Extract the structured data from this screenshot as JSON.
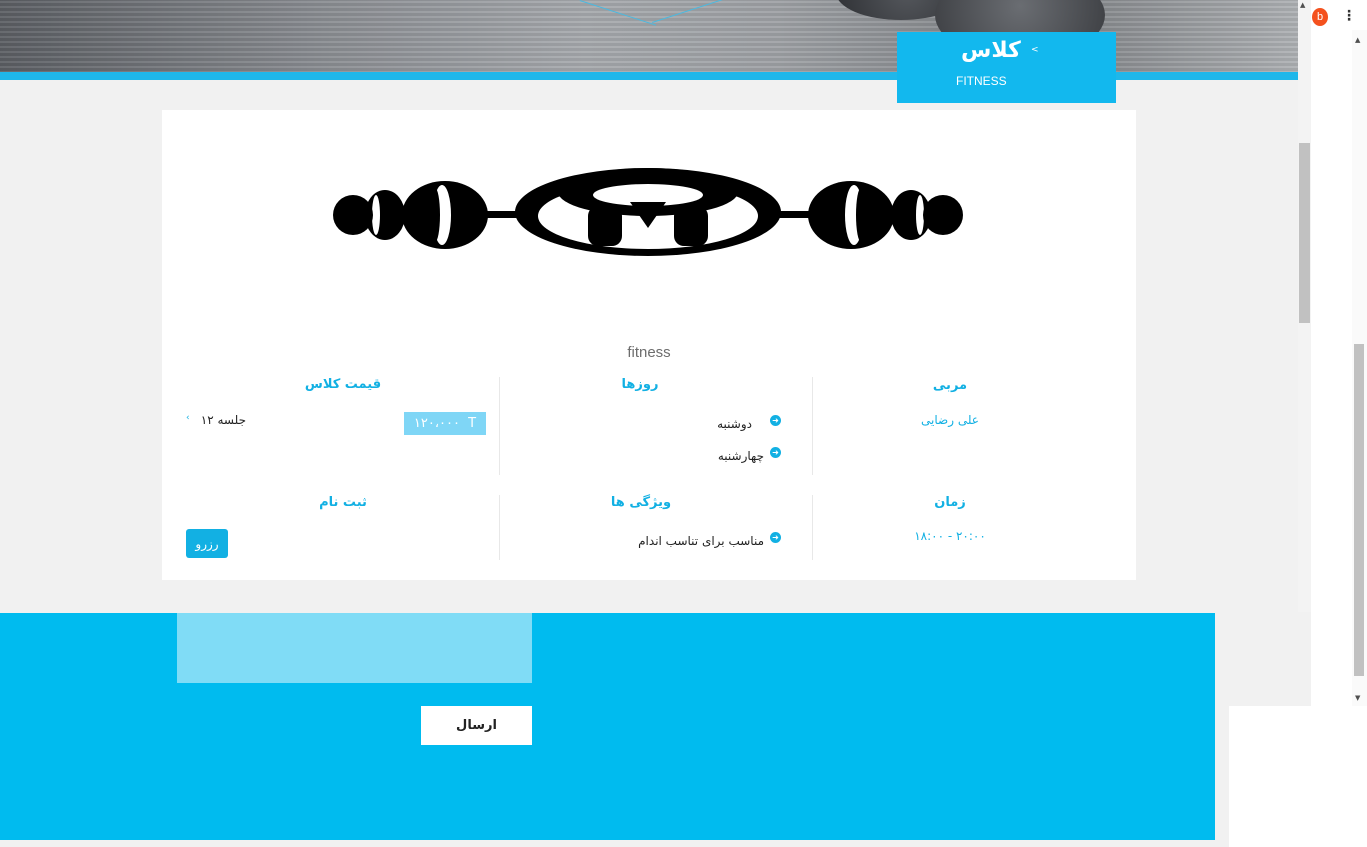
{
  "header": {
    "title": "کلاس",
    "chevron": "<",
    "subtitle": "FITNESS"
  },
  "class": {
    "name": "fitness",
    "coach": {
      "heading": "مربی",
      "value": "علی رضایی"
    },
    "days": {
      "heading": "روزها",
      "items": [
        "دوشنبه",
        "چهارشنبه"
      ]
    },
    "price": {
      "heading": "قیمت کلاس",
      "amount": "۱۲۰،۰۰۰",
      "currency": "T",
      "sessions": "جلسه ۱۲",
      "chevron": "‹"
    },
    "time": {
      "heading": "زمان",
      "value": "۱۸:۰۰ - ۲۰:۰۰"
    },
    "features": {
      "heading": "ویژگی ها",
      "items": [
        "مناسب برای تناسب اندام"
      ]
    },
    "register": {
      "heading": "ثبت نام",
      "button_label": "رزرو"
    }
  },
  "footer": {
    "send_label": "ارسال"
  },
  "browser": {
    "avatar_letter": "b",
    "menu_glyph": "⋮",
    "arrow_up": "▲",
    "arrow_down": "▼"
  },
  "colors": {
    "accent": "#12b0e3",
    "title_box": "#12b8ee",
    "footer": "#00bbef",
    "price_box": "#7fd6f6"
  }
}
